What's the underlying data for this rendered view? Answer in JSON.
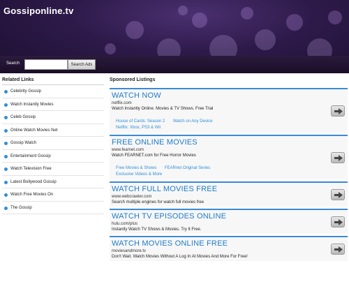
{
  "site": {
    "title": "Gossiponline.tv"
  },
  "search": {
    "label": "Search",
    "placeholder": "",
    "button": "Search Ads"
  },
  "sidebar": {
    "title": "Related Links",
    "items": [
      "Celebrity Gossip",
      "Watch Instantly Movies",
      "Celeb Gossip",
      "Online Watch Movies Net",
      "Gossip Watch",
      "Entertainment Gossip",
      "Watch Television Free",
      "Latest Bollywood Gossip",
      "Watch Free Movies On",
      "The Gossip"
    ]
  },
  "main": {
    "title": "Sponsored Listings",
    "listings": [
      {
        "title": "WATCH NOW",
        "url": "netflix.com",
        "desc": "Watch Instantly Online. Movies & TV Shows. Free Trial",
        "sublinks": [
          "House of Cards: Season 2",
          "Watch on Any Device",
          "Netflix: Xbox, PS3 & Wii"
        ]
      },
      {
        "title": "FREE ONLINE MOVIES",
        "url": "www.fearnet.com",
        "desc": "Watch FEARNET.com for Free Horror Movies",
        "sublinks": [
          "Free Movies & Shows",
          "FEARnet Original Series",
          "Exclusive Videos & More"
        ]
      },
      {
        "title": "WATCH FULL MOVIES FREE",
        "url": "www.webcrawler.com",
        "desc": "Search multiple engines for watch full movies free",
        "sublinks": []
      },
      {
        "title": "WATCH TV EPISODES ONLINE",
        "url": "hulu.com/plus",
        "desc": "Instantly Watch TV Shows & Movies. Try It Free.",
        "sublinks": []
      },
      {
        "title": "WATCH MOVIES ONLINE FREE",
        "url": "moviesandmore.tv",
        "desc": "Don't Wait. Watch Movies Without A Log In At Movies And More For Free!",
        "sublinks": []
      }
    ]
  },
  "colors": {
    "accent": "#1f7cc8",
    "header_bg": "#2e1a4a",
    "bullet": "#2f8fd8"
  },
  "icons": {
    "listing_arrow": "arrow-right-icon",
    "bullet": "bullet-icon"
  }
}
